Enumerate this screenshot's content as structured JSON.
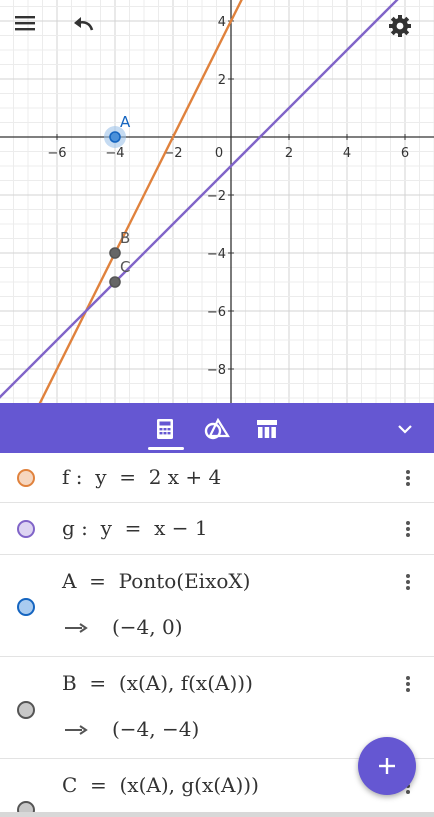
{
  "graph": {
    "x_ticks": [
      "−6",
      "−4",
      "−2",
      "0",
      "2",
      "4",
      "6"
    ],
    "y_ticks": [
      "4",
      "2",
      "−2",
      "−4",
      "−6",
      "−8"
    ],
    "x_tick_values": [
      -6,
      -4,
      -2,
      0,
      2,
      4,
      6
    ],
    "y_tick_values": [
      4,
      2,
      -2,
      -4,
      -6,
      -8
    ],
    "x_range": [
      -8,
      7
    ],
    "y_range": [
      -9,
      4.7
    ],
    "lines": [
      {
        "label": "f",
        "slope": 2,
        "intercept": 4,
        "color": "#e0823d"
      },
      {
        "label": "g",
        "slope": 1,
        "intercept": -1,
        "color": "#8064c8"
      }
    ],
    "points": [
      {
        "label": "A",
        "x": -4,
        "y": 0,
        "color": "#1565c0",
        "label_color": "#1565c0"
      },
      {
        "label": "B",
        "x": -4,
        "y": -4,
        "color": "#555555",
        "label_color": "#555555"
      },
      {
        "label": "C",
        "x": -4,
        "y": -5,
        "color": "#555555",
        "label_color": "#555555"
      }
    ],
    "grid": true
  },
  "toolbar": {
    "accent": "#6557d2",
    "active_tab": "algebra"
  },
  "algebra": {
    "rows": [
      {
        "name": "f",
        "expr": "f :  y  =  2 x + 4",
        "output": "",
        "dot_border": "#e0823d",
        "dot_fill": "#f6d6bf"
      },
      {
        "name": "g",
        "expr": "g :  y  =  x − 1",
        "output": "",
        "dot_border": "#8064c8",
        "dot_fill": "#ddd4f2"
      },
      {
        "name": "A",
        "expr": "A  =  Ponto(EixoX)",
        "output": "(−4, 0)",
        "dot_border": "#1565c0",
        "dot_fill": "#a9cbf0"
      },
      {
        "name": "B",
        "expr": "B  =  (x(A), f(x(A)))",
        "output": "(−4, −4)",
        "dot_border": "#555555",
        "dot_fill": "#c8c8c8"
      },
      {
        "name": "C",
        "expr": "C  =  (x(A), g(x(A)))",
        "output": "",
        "dot_border": "#555555",
        "dot_fill": "#c8c8c8"
      }
    ]
  },
  "icons": {
    "menu": "hamburger-menu-icon",
    "undo": "undo-icon",
    "settings": "gear-icon",
    "algebra_tab": "calculator-icon",
    "tools_tab": "tools-shapes-icon",
    "table_tab": "table-icon",
    "collapse": "chevron-down-icon",
    "add": "plus-icon",
    "more": "more-vertical-icon",
    "output_arrow": "long-right-arrow-icon"
  }
}
